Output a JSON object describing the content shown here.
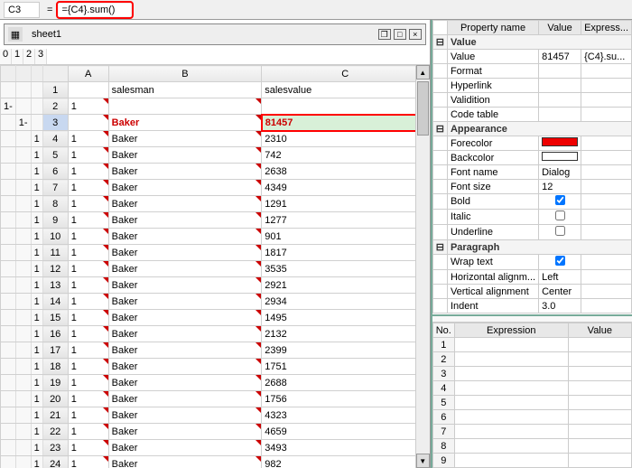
{
  "formula": {
    "cell_ref": "C3",
    "expr": "={C4}.sum()"
  },
  "sheet": {
    "name": "sheet1",
    "outline_levels": [
      "0",
      "1",
      "2",
      "3"
    ],
    "columns": [
      "A",
      "B",
      "C"
    ],
    "headers": {
      "A": "",
      "B": "salesman",
      "C": "salesvalue"
    }
  },
  "rows": [
    {
      "n": 1,
      "a": "",
      "b": "salesman",
      "c": "salesvalue",
      "g": [
        "",
        "",
        ""
      ]
    },
    {
      "n": 2,
      "a": "1",
      "b": "",
      "c": "",
      "g": [
        "1-",
        "",
        ""
      ]
    },
    {
      "n": 3,
      "a": "",
      "b": "Baker",
      "c": "81457",
      "g": [
        "",
        "1-",
        ""
      ],
      "sel": true,
      "red": true
    },
    {
      "n": 4,
      "a": "1",
      "b": "Baker",
      "c": "2310",
      "g": [
        "",
        "",
        "1"
      ]
    },
    {
      "n": 5,
      "a": "1",
      "b": "Baker",
      "c": "742",
      "g": [
        "",
        "",
        "1"
      ]
    },
    {
      "n": 6,
      "a": "1",
      "b": "Baker",
      "c": "2638",
      "g": [
        "",
        "",
        "1"
      ]
    },
    {
      "n": 7,
      "a": "1",
      "b": "Baker",
      "c": "4349",
      "g": [
        "",
        "",
        "1"
      ]
    },
    {
      "n": 8,
      "a": "1",
      "b": "Baker",
      "c": "1291",
      "g": [
        "",
        "",
        "1"
      ]
    },
    {
      "n": 9,
      "a": "1",
      "b": "Baker",
      "c": "1277",
      "g": [
        "",
        "",
        "1"
      ]
    },
    {
      "n": 10,
      "a": "1",
      "b": "Baker",
      "c": "901",
      "g": [
        "",
        "",
        "1"
      ]
    },
    {
      "n": 11,
      "a": "1",
      "b": "Baker",
      "c": "1817",
      "g": [
        "",
        "",
        "1"
      ]
    },
    {
      "n": 12,
      "a": "1",
      "b": "Baker",
      "c": "3535",
      "g": [
        "",
        "",
        "1"
      ]
    },
    {
      "n": 13,
      "a": "1",
      "b": "Baker",
      "c": "2921",
      "g": [
        "",
        "",
        "1"
      ]
    },
    {
      "n": 14,
      "a": "1",
      "b": "Baker",
      "c": "2934",
      "g": [
        "",
        "",
        "1"
      ]
    },
    {
      "n": 15,
      "a": "1",
      "b": "Baker",
      "c": "1495",
      "g": [
        "",
        "",
        "1"
      ]
    },
    {
      "n": 16,
      "a": "1",
      "b": "Baker",
      "c": "2132",
      "g": [
        "",
        "",
        "1"
      ]
    },
    {
      "n": 17,
      "a": "1",
      "b": "Baker",
      "c": "2399",
      "g": [
        "",
        "",
        "1"
      ]
    },
    {
      "n": 18,
      "a": "1",
      "b": "Baker",
      "c": "1751",
      "g": [
        "",
        "",
        "1"
      ]
    },
    {
      "n": 19,
      "a": "1",
      "b": "Baker",
      "c": "2688",
      "g": [
        "",
        "",
        "1"
      ]
    },
    {
      "n": 20,
      "a": "1",
      "b": "Baker",
      "c": "1756",
      "g": [
        "",
        "",
        "1"
      ]
    },
    {
      "n": 21,
      "a": "1",
      "b": "Baker",
      "c": "4323",
      "g": [
        "",
        "",
        "1"
      ]
    },
    {
      "n": 22,
      "a": "1",
      "b": "Baker",
      "c": "4659",
      "g": [
        "",
        "",
        "1"
      ]
    },
    {
      "n": 23,
      "a": "1",
      "b": "Baker",
      "c": "3493",
      "g": [
        "",
        "",
        "1"
      ]
    },
    {
      "n": 24,
      "a": "1",
      "b": "Baker",
      "c": "982",
      "g": [
        "",
        "",
        "1"
      ]
    }
  ],
  "props": {
    "header": [
      "Property name",
      "Value",
      "Express..."
    ],
    "groups": [
      {
        "name": "Value",
        "items": [
          {
            "k": "Value",
            "v": "81457",
            "e": "{C4}.su..."
          },
          {
            "k": "Format",
            "v": ""
          },
          {
            "k": "Hyperlink",
            "v": ""
          },
          {
            "k": "Validition",
            "v": ""
          },
          {
            "k": "Code table",
            "v": ""
          }
        ]
      },
      {
        "name": "Appearance",
        "items": [
          {
            "k": "Forecolor",
            "v": "",
            "swatch": "red"
          },
          {
            "k": "Backcolor",
            "v": "",
            "swatch": "white"
          },
          {
            "k": "Font name",
            "v": "Dialog"
          },
          {
            "k": "Font size",
            "v": "12"
          },
          {
            "k": "Bold",
            "v": "",
            "chk": true
          },
          {
            "k": "Italic",
            "v": "",
            "chk": false
          },
          {
            "k": "Underline",
            "v": "",
            "chk": false
          }
        ]
      },
      {
        "name": "Paragraph",
        "items": [
          {
            "k": "Wrap text",
            "v": "",
            "chk": true
          },
          {
            "k": "Horizontal alignm...",
            "v": "Left"
          },
          {
            "k": "Vertical alignment",
            "v": "Center"
          },
          {
            "k": "Indent",
            "v": "3.0"
          }
        ]
      }
    ]
  },
  "expr_panel": {
    "header": [
      "No.",
      "Expression",
      "Value"
    ],
    "rows": [
      1,
      2,
      3,
      4,
      5,
      6,
      7,
      8,
      9
    ]
  }
}
